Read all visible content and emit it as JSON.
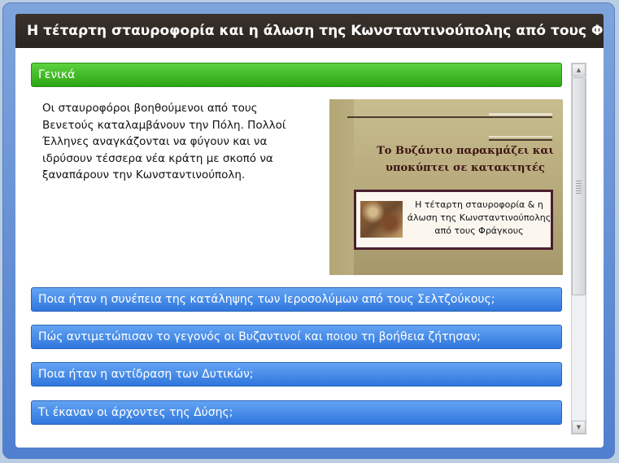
{
  "title": "Η τέταρτη σταυροφορία και η άλωση της Κωνσταντινούπολης από τους Φράγκους",
  "accordion": [
    {
      "label": "Γενικά",
      "state": "expanded",
      "color": "#2ea614"
    },
    {
      "label": "Ποια ήταν η συνέπεια της κατάληψης των Ιεροσολύμων από τους Σελτζούκους;",
      "state": "collapsed",
      "color": "#2f76dd"
    },
    {
      "label": "Πώς αντιμετώπισαν το γεγονός οι Βυζαντινοί και ποιου τη βοήθεια ζήτησαν;",
      "state": "collapsed",
      "color": "#2f76dd"
    },
    {
      "label": "Ποια ήταν η αντίδραση των Δυτικών;",
      "state": "collapsed",
      "color": "#2f76dd"
    },
    {
      "label": "Τι έκαναν οι άρχοντες της Δύσης;",
      "state": "collapsed",
      "color": "#2f76dd"
    }
  ],
  "general": {
    "text": "Οι σταυροφόροι βοηθούμενοι από τους Βενετούς καταλαμβάνουν την Πόλη. Πολλοί Έλληνες αναγκάζονται να φύγουν και να ιδρύσουν τέσσερα νέα κράτη με σκοπό να ξαναπάρουν την Κωνσταντινούπολη."
  },
  "thumbnail": {
    "heading": "Το Βυζάντιο παρακμάζει και υποκύπτει σε κατακτητές",
    "caption": "Η τέταρτη σταυροφορία & η άλωση της Κωνσταντινούπολης από τους Φράγκους"
  },
  "scrollbar": {
    "up_icon": "▲",
    "down_icon": "▼"
  }
}
